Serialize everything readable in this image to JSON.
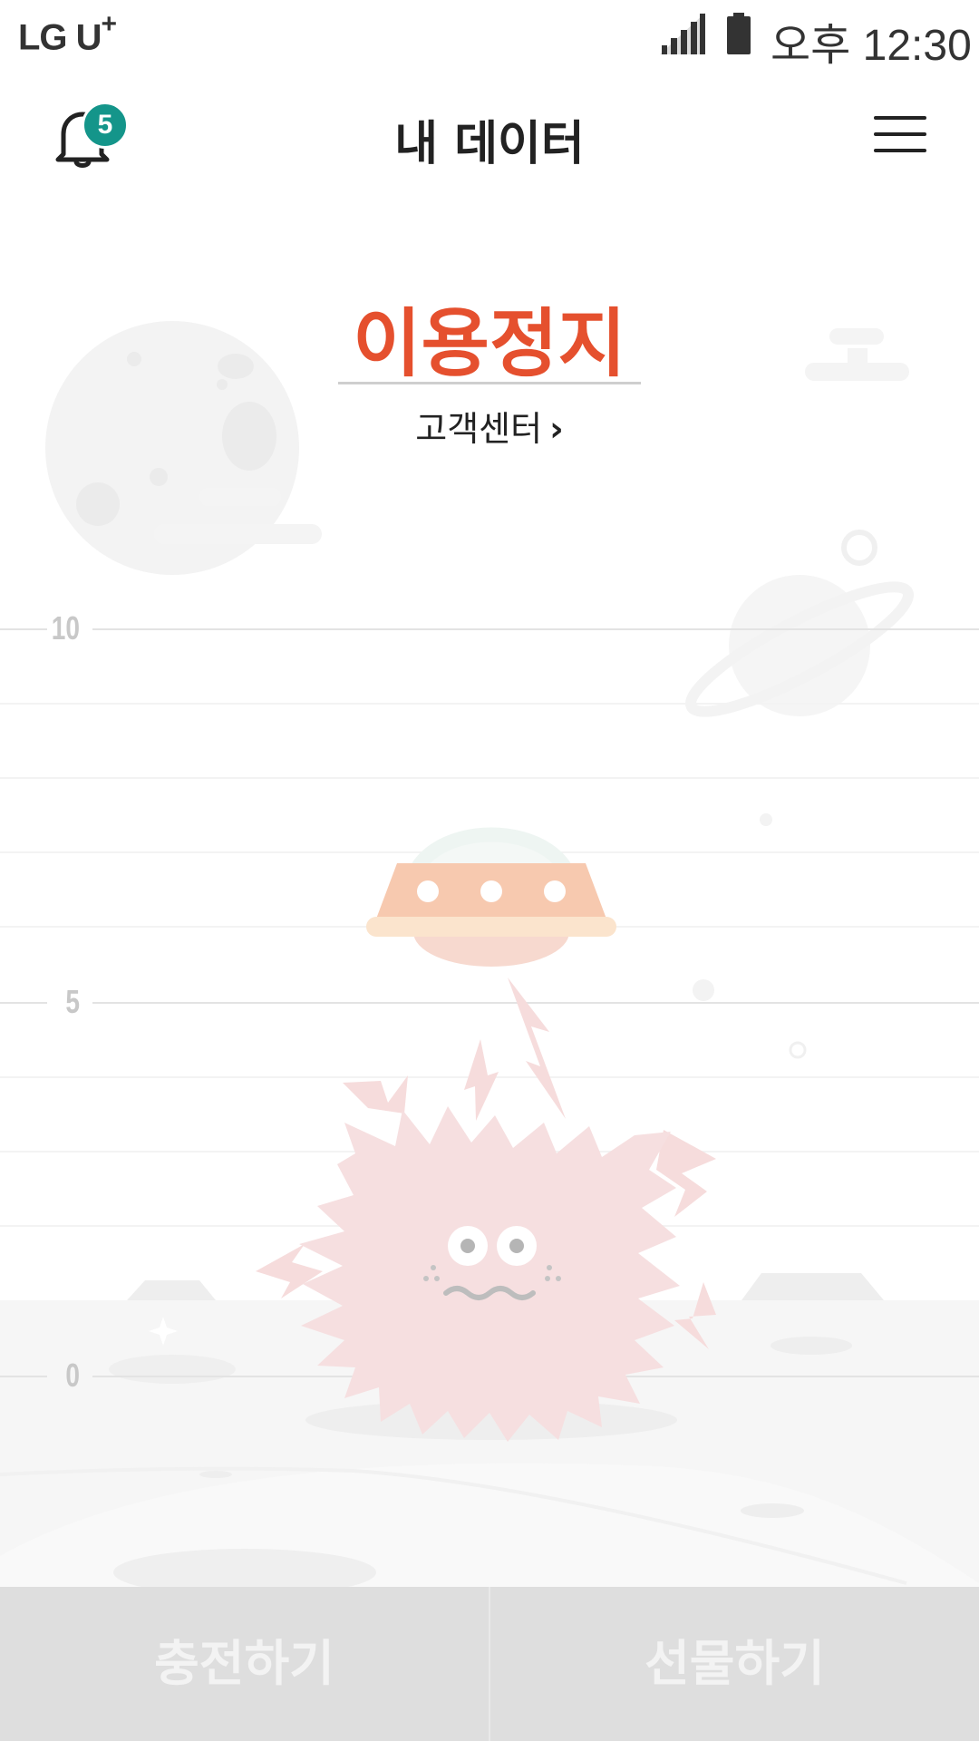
{
  "status_bar": {
    "carrier": "LG U",
    "carrier_plus": "+",
    "time": "오후 12:30"
  },
  "header": {
    "title": "내 데이터",
    "notification_count": "5"
  },
  "main": {
    "status": "이용정지",
    "customer_center_link": "고객센터",
    "chevron": "›",
    "axis_labels": [
      "10",
      "5",
      "0"
    ]
  },
  "footer": {
    "charge_label": "충전하기",
    "gift_label": "선물하기"
  },
  "colors": {
    "status_red": "#e5502e",
    "badge_teal": "#14958a",
    "disabled_button_bg": "#dedede"
  },
  "icons": [
    "bell-icon",
    "menu-icon",
    "signal-icon",
    "battery-icon",
    "chevron-right-icon"
  ]
}
